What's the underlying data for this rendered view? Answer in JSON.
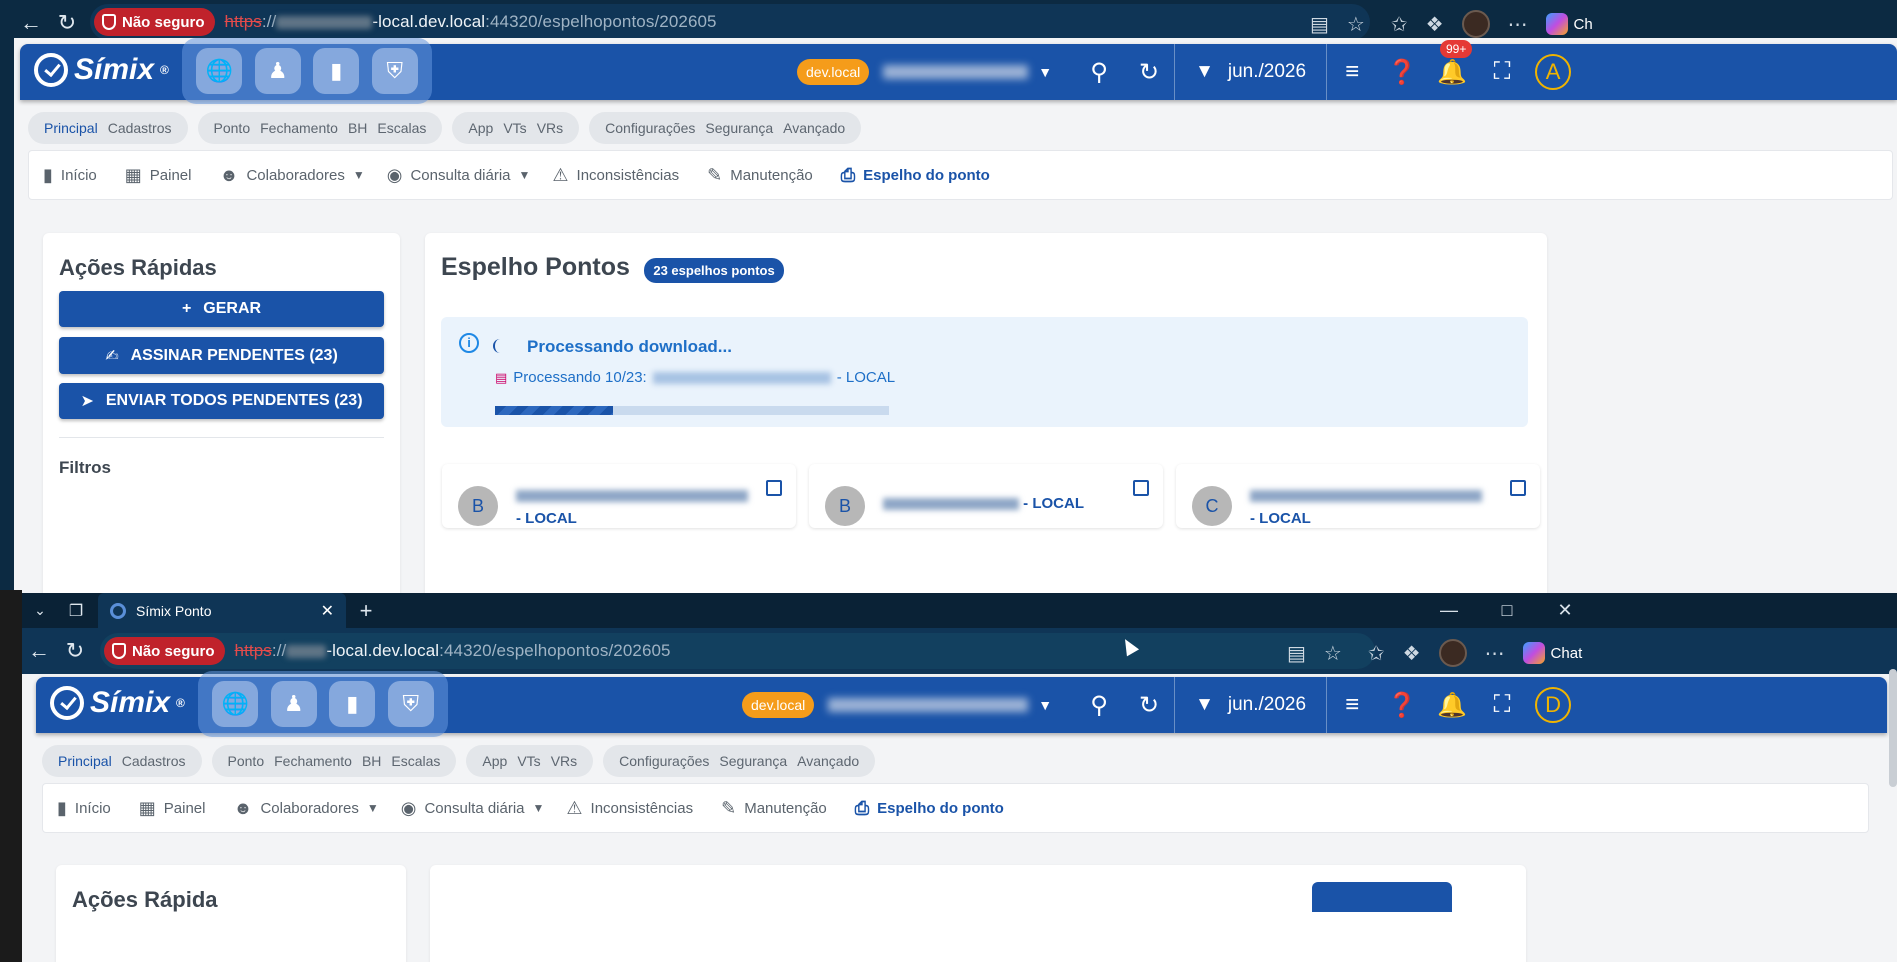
{
  "browser": {
    "not_secure_label": "Não seguro",
    "url_https": "https",
    "url_host": "-local.dev.local",
    "url_path": ":44320/espelhopontos/202605",
    "win1_chat_label": "Ch",
    "win2_chat_label": "Chat"
  },
  "tab": {
    "title": "Símix Ponto"
  },
  "app": {
    "brand": "Símix",
    "env_chip": "dev.local",
    "period": "jun./2026",
    "notifications_badge": "99+",
    "user_initial_win1": "A",
    "user_initial_win2": "D"
  },
  "modules": {
    "g1": [
      "Principal",
      "Cadastros"
    ],
    "g2": [
      "Ponto",
      "Fechamento",
      "BH",
      "Escalas"
    ],
    "g3": [
      "App",
      "VTs",
      "VRs"
    ],
    "g4": [
      "Configurações",
      "Segurança",
      "Avançado"
    ]
  },
  "menu": {
    "inicio": "Início",
    "painel": "Painel",
    "colaboradores": "Colaboradores",
    "consulta": "Consulta diária",
    "inconsistencias": "Inconsistências",
    "manutencao": "Manutenção",
    "espelho": "Espelho do ponto"
  },
  "quick_actions": {
    "title": "Ações Rápidas",
    "title_partial": "Ações Rápida",
    "gerar": "GERAR",
    "assinar": "ASSINAR PENDENTES (23)",
    "enviar": "ENVIAR TODOS PENDENTES (23)",
    "filtros": "Filtros"
  },
  "main": {
    "title": "Espelho Pontos",
    "count_chip": "23 espelhos pontos",
    "processing_title": "Processando download...",
    "processing_detail_prefix": "Processando 10/23:",
    "processing_detail_suffix": "- LOCAL",
    "progress": 0.3
  },
  "employees": [
    {
      "initial": "B",
      "suffix": "- LOCAL"
    },
    {
      "initial": "B",
      "suffix": "- LOCAL"
    },
    {
      "initial": "C",
      "suffix": "- LOCAL"
    }
  ]
}
